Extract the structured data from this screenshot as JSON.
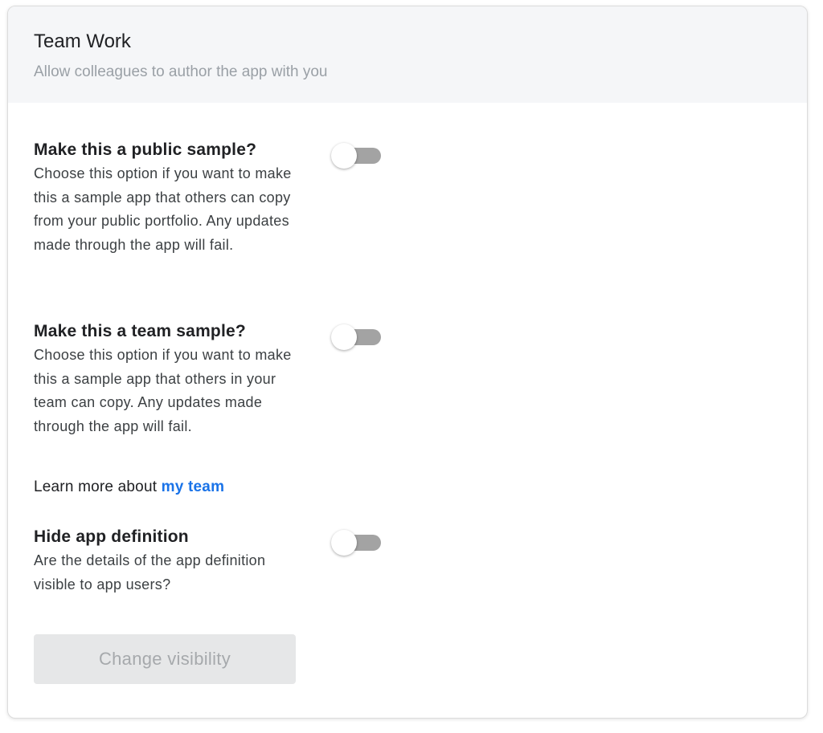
{
  "header": {
    "title": "Team Work",
    "subtitle": "Allow colleagues to author the app with you"
  },
  "settings": [
    {
      "title": "Make this a public sample?",
      "description": "Choose this option if you want to make this a sample app that others can copy from your public portfolio. Any updates made through the app will fail.",
      "enabled": false
    },
    {
      "title": "Make this a team sample?",
      "description": "Choose this option if you want to make this a sample app that others in your team can copy. Any updates made through the app will fail.",
      "enabled": false
    },
    {
      "title": "Hide app definition",
      "description": "Are the details of the app definition visible to app users?",
      "enabled": false
    }
  ],
  "learn_more": {
    "prefix": "Learn more about ",
    "link_label": "my team"
  },
  "change_visibility_label": "Change visibility",
  "colors": {
    "link": "#1a73e8",
    "toggle_track_off": "#a3a3a3",
    "header_bg": "#f5f6f8",
    "button_disabled_bg": "#e6e7e8"
  }
}
